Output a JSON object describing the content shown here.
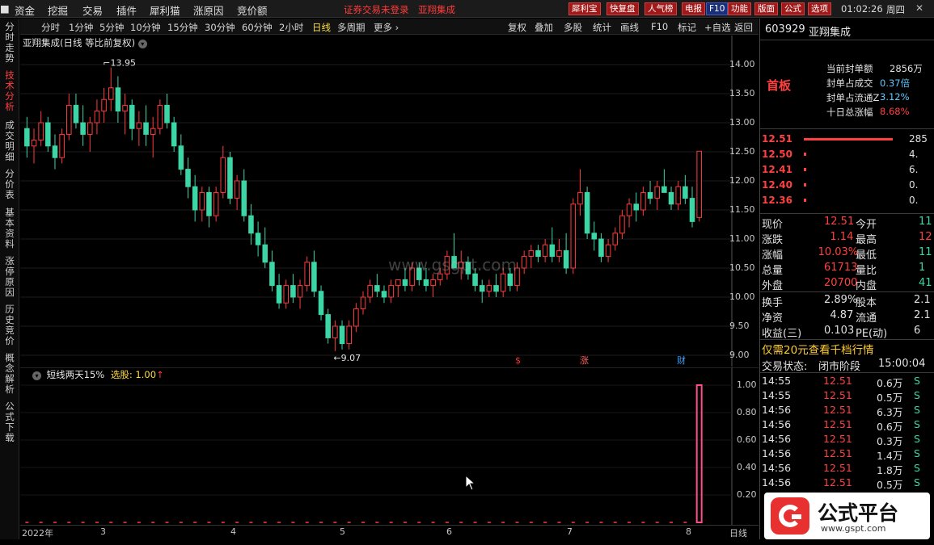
{
  "menubar": {
    "items": [
      "资金",
      "挖掘",
      "交易",
      "插件",
      "犀利猫",
      "涨原因",
      "竞价额"
    ],
    "status": "证券交易未登录",
    "stock": "亚翔集成",
    "buttons": [
      "犀利宝",
      "快复盘",
      "人气榜",
      "电报",
      "F10",
      "功能",
      "版面",
      "公式",
      "选项"
    ],
    "time": "01:02:26",
    "weekday": "周四",
    "minimize": "—",
    "maximize": "□",
    "close": "✕"
  },
  "leftbar": {
    "tabs": [
      "分时走势",
      "技术分析",
      "成交明细",
      "分价表",
      "基本资料",
      "涨停原因",
      "历史竞价",
      "概念解析",
      "公式下载"
    ],
    "active": 1
  },
  "periodbar": {
    "items": [
      "分时",
      "1分钟",
      "5分钟",
      "10分钟",
      "15分钟",
      "30分钟",
      "60分钟",
      "2小时",
      "日线",
      "多周期",
      "更多 ›"
    ],
    "active_index": 8,
    "right_items": [
      "复权",
      "叠加",
      "多股",
      "统计",
      "画线",
      "F10",
      "标记",
      "+自选",
      "返回"
    ]
  },
  "chart": {
    "title": "亚翔集成(日线 等比前复权)",
    "yticks": [
      "14.00",
      "13.50",
      "13.00",
      "12.50",
      "12.00",
      "11.50",
      "11.00",
      "10.50",
      "10.00",
      "9.50",
      "9.00"
    ],
    "ymin": 9.0,
    "ymax": 14.0,
    "high_label": "13.95",
    "low_label": "9.07",
    "markers": [
      {
        "text": "$",
        "color": "#ff3030"
      },
      {
        "text": "涨",
        "color": "#ff6060"
      },
      {
        "text": "财",
        "color": "#40a0ff"
      }
    ],
    "watermark": "www.gsgpt.com",
    "up_color": "#ff3c3c",
    "down_color": "#3cd6a6"
  },
  "indicator": {
    "title": "短线两天15%",
    "select_label": "选股: 1.00",
    "yticks": [
      "1.00",
      "0.80",
      "0.60",
      "0.40",
      "0.20"
    ],
    "bar_color": "#ff4d8a"
  },
  "xaxis": {
    "labels": [
      "2022年",
      "3",
      "4",
      "5",
      "6",
      "7",
      "8"
    ],
    "period": "日线"
  },
  "quote": {
    "code": "603929",
    "name": "亚翔集成",
    "board": "首板",
    "seal": [
      {
        "label": "当前封单额",
        "value": "2856万"
      },
      {
        "label": "封单占成交",
        "value": "0.37倍"
      },
      {
        "label": "封单占流通Z",
        "value": "3.12%"
      },
      {
        "label": "十日总涨幅",
        "value": "8.68%"
      }
    ],
    "levels": [
      {
        "price": "12.51",
        "vol": "285"
      },
      {
        "price": "12.50",
        "vol": "4."
      },
      {
        "price": "12.41",
        "vol": "6."
      },
      {
        "price": "12.40",
        "vol": "0."
      },
      {
        "price": "12.36",
        "vol": "0."
      }
    ],
    "stats": [
      {
        "l1": "现价",
        "v1": "12.51",
        "l2": "今开",
        "v2": "11"
      },
      {
        "l1": "涨跌",
        "v1": "1.14",
        "l2": "最高",
        "v2": "12"
      },
      {
        "l1": "涨幅",
        "v1": "10.03%",
        "l2": "最低",
        "v2": "11"
      },
      {
        "l1": "总量",
        "v1": "61713",
        "l2": "量比",
        "v2": "1"
      },
      {
        "l1": "外盘",
        "v1": "20700",
        "l2": "内盘",
        "v2": "41"
      }
    ],
    "stats2": [
      {
        "l1": "换手",
        "v1": "2.89%",
        "l2": "股本",
        "v2": "2.1"
      },
      {
        "l1": "净资",
        "v1": "4.87",
        "l2": "流通",
        "v2": "2.1"
      },
      {
        "l1": "收益(三)",
        "v1": "0.103",
        "l2": "PE(动)",
        "v2": "6"
      }
    ],
    "promo": "仅需20元查看千档行情",
    "trade_state_label": "交易状态:",
    "trade_state": "闭市阶段",
    "trade_time": "15:00:04",
    "ticks": [
      {
        "time": "14:55",
        "price": "12.51",
        "vol": "0.6万",
        "bs": "S"
      },
      {
        "time": "14:55",
        "price": "12.51",
        "vol": "0.5万",
        "bs": "S"
      },
      {
        "time": "14:56",
        "price": "12.51",
        "vol": "6.3万",
        "bs": "S"
      },
      {
        "time": "14:56",
        "price": "12.51",
        "vol": "0.6万",
        "bs": "S"
      },
      {
        "time": "14:56",
        "price": "12.51",
        "vol": "0.3万",
        "bs": "S"
      },
      {
        "time": "14:56",
        "price": "12.51",
        "vol": "1.4万",
        "bs": "S"
      },
      {
        "time": "14:56",
        "price": "12.51",
        "vol": "1.8万",
        "bs": "S"
      },
      {
        "time": "14:56",
        "price": "12.51",
        "vol": "0.5万",
        "bs": "S"
      }
    ]
  },
  "logo": {
    "name": "公式平台",
    "url": "www.gspt.com"
  },
  "chart_data": {
    "type": "candlestick",
    "title": "亚翔集成(日线 等比前复权)",
    "ylim": [
      9.0,
      14.0
    ],
    "x_labels": [
      "2022年",
      "3",
      "4",
      "5",
      "6",
      "7",
      "8"
    ],
    "ohlc": [
      [
        12.9,
        13.1,
        12.4,
        12.6
      ],
      [
        12.6,
        12.9,
        12.3,
        12.7
      ],
      [
        12.7,
        13.2,
        12.6,
        13.0
      ],
      [
        13.0,
        13.1,
        12.5,
        12.6
      ],
      [
        12.6,
        12.8,
        12.2,
        12.4
      ],
      [
        12.4,
        12.9,
        12.3,
        12.8
      ],
      [
        12.8,
        13.5,
        12.7,
        13.3
      ],
      [
        13.3,
        13.5,
        12.9,
        13.0
      ],
      [
        13.0,
        13.3,
        12.6,
        12.8
      ],
      [
        12.8,
        13.1,
        12.5,
        13.0
      ],
      [
        13.0,
        13.4,
        12.8,
        13.2
      ],
      [
        13.2,
        13.6,
        13.0,
        13.4
      ],
      [
        13.4,
        13.95,
        13.2,
        13.6
      ],
      [
        13.6,
        13.8,
        13.0,
        13.2
      ],
      [
        13.2,
        13.5,
        12.8,
        13.3
      ],
      [
        13.3,
        13.4,
        12.7,
        12.9
      ],
      [
        12.9,
        13.2,
        12.6,
        13.0
      ],
      [
        13.0,
        13.3,
        12.6,
        12.8
      ],
      [
        12.8,
        13.1,
        12.4,
        12.9
      ],
      [
        12.9,
        13.4,
        12.8,
        13.3
      ],
      [
        13.3,
        13.5,
        12.9,
        13.0
      ],
      [
        13.0,
        13.1,
        12.5,
        12.6
      ],
      [
        12.6,
        12.8,
        12.1,
        12.2
      ],
      [
        12.2,
        12.4,
        11.7,
        11.9
      ],
      [
        11.9,
        12.1,
        11.3,
        11.5
      ],
      [
        11.5,
        11.9,
        11.3,
        11.8
      ],
      [
        11.8,
        11.9,
        11.2,
        11.4
      ],
      [
        11.4,
        11.9,
        11.3,
        11.8
      ],
      [
        11.8,
        12.6,
        11.7,
        12.4
      ],
      [
        12.4,
        12.5,
        11.6,
        11.7
      ],
      [
        11.7,
        12.1,
        11.5,
        12.0
      ],
      [
        12.0,
        12.2,
        11.3,
        11.4
      ],
      [
        11.4,
        11.6,
        10.9,
        11.1
      ],
      [
        11.1,
        11.3,
        10.7,
        10.9
      ],
      [
        10.9,
        11.2,
        10.5,
        10.6
      ],
      [
        10.6,
        10.8,
        10.1,
        10.2
      ],
      [
        10.2,
        10.4,
        9.8,
        9.9
      ],
      [
        9.9,
        10.3,
        9.8,
        10.2
      ],
      [
        10.2,
        10.4,
        9.9,
        10.0
      ],
      [
        10.0,
        10.3,
        9.8,
        10.2
      ],
      [
        10.2,
        10.7,
        10.1,
        10.6
      ],
      [
        10.6,
        10.8,
        10.0,
        10.1
      ],
      [
        10.1,
        10.2,
        9.6,
        9.7
      ],
      [
        9.7,
        9.8,
        9.2,
        9.3
      ],
      [
        9.3,
        9.6,
        9.07,
        9.5
      ],
      [
        9.5,
        9.6,
        9.1,
        9.2
      ],
      [
        9.2,
        9.6,
        9.1,
        9.5
      ],
      [
        9.5,
        9.9,
        9.4,
        9.8
      ],
      [
        9.8,
        10.1,
        9.7,
        10.0
      ],
      [
        10.0,
        10.3,
        9.9,
        10.2
      ],
      [
        10.2,
        10.4,
        10.0,
        10.1
      ],
      [
        10.1,
        10.2,
        9.9,
        10.0
      ],
      [
        10.0,
        10.3,
        9.9,
        10.2
      ],
      [
        10.2,
        10.3,
        10.0,
        10.3
      ],
      [
        10.3,
        10.5,
        10.1,
        10.2
      ],
      [
        10.2,
        10.6,
        10.1,
        10.5
      ],
      [
        10.5,
        10.6,
        10.2,
        10.3
      ],
      [
        10.3,
        10.5,
        10.1,
        10.2
      ],
      [
        10.2,
        10.4,
        10.0,
        10.3
      ],
      [
        10.3,
        10.5,
        10.2,
        10.4
      ],
      [
        10.4,
        10.8,
        10.3,
        10.7
      ],
      [
        10.7,
        11.1,
        10.6,
        10.5
      ],
      [
        10.5,
        10.8,
        10.3,
        10.6
      ],
      [
        10.6,
        10.7,
        10.3,
        10.4
      ],
      [
        10.4,
        10.5,
        10.1,
        10.2
      ],
      [
        10.2,
        10.3,
        9.9,
        10.1
      ],
      [
        10.1,
        10.3,
        10.0,
        10.2
      ],
      [
        10.2,
        10.4,
        10.0,
        10.1
      ],
      [
        10.1,
        10.5,
        10.0,
        10.4
      ],
      [
        10.4,
        10.5,
        10.1,
        10.2
      ],
      [
        10.2,
        10.6,
        10.1,
        10.5
      ],
      [
        10.5,
        10.8,
        10.4,
        10.7
      ],
      [
        10.7,
        10.9,
        10.5,
        10.8
      ],
      [
        10.8,
        10.9,
        10.6,
        10.7
      ],
      [
        10.7,
        11.0,
        10.6,
        10.9
      ],
      [
        10.9,
        11.2,
        10.6,
        10.7
      ],
      [
        10.7,
        11.0,
        10.6,
        10.8
      ],
      [
        10.8,
        11.1,
        10.4,
        10.5
      ],
      [
        10.5,
        11.7,
        10.4,
        11.6
      ],
      [
        11.6,
        12.2,
        11.4,
        11.8
      ],
      [
        11.8,
        11.9,
        11.0,
        11.1
      ],
      [
        11.1,
        11.3,
        10.8,
        11.0
      ],
      [
        11.0,
        11.1,
        10.6,
        10.7
      ],
      [
        10.7,
        11.0,
        10.6,
        10.9
      ],
      [
        10.9,
        11.2,
        10.8,
        11.1
      ],
      [
        11.1,
        11.5,
        11.0,
        11.4
      ],
      [
        11.4,
        11.7,
        11.2,
        11.6
      ],
      [
        11.6,
        11.8,
        11.3,
        11.5
      ],
      [
        11.5,
        11.9,
        11.4,
        11.8
      ],
      [
        11.8,
        12.0,
        11.6,
        11.7
      ],
      [
        11.7,
        12.0,
        11.5,
        11.9
      ],
      [
        11.9,
        12.2,
        11.8,
        11.8
      ],
      [
        11.8,
        11.9,
        11.5,
        11.6
      ],
      [
        11.6,
        12.0,
        11.5,
        11.9
      ],
      [
        11.9,
        12.1,
        11.6,
        11.7
      ],
      [
        11.7,
        11.9,
        11.2,
        11.3
      ],
      [
        11.37,
        12.51,
        11.3,
        12.51
      ]
    ],
    "indicator_series": {
      "name": "短线两天15%",
      "values_last": 1.0
    }
  }
}
